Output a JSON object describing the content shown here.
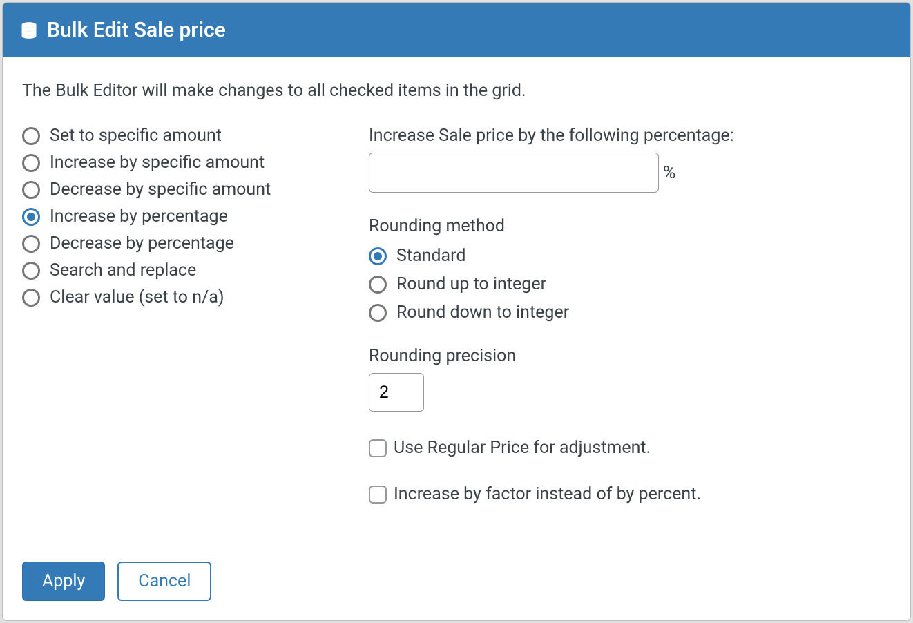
{
  "header": {
    "title": "Bulk Edit Sale price"
  },
  "description": "The Bulk Editor will make changes to all checked items in the grid.",
  "operations": {
    "selected": "increase_percent",
    "items": [
      {
        "id": "set_specific",
        "label": "Set to specific amount"
      },
      {
        "id": "increase_specific",
        "label": "Increase by specific amount"
      },
      {
        "id": "decrease_specific",
        "label": "Decrease by specific amount"
      },
      {
        "id": "increase_percent",
        "label": "Increase by percentage"
      },
      {
        "id": "decrease_percent",
        "label": "Decrease by percentage"
      },
      {
        "id": "search_replace",
        "label": "Search and replace"
      },
      {
        "id": "clear_value",
        "label": "Clear value (set to n/a)"
      }
    ]
  },
  "percentage_field": {
    "label": "Increase Sale price by the following percentage:",
    "value": "",
    "suffix": "%"
  },
  "rounding_method": {
    "heading": "Rounding method",
    "selected": "standard",
    "items": [
      {
        "id": "standard",
        "label": "Standard"
      },
      {
        "id": "round_up",
        "label": "Round up to integer"
      },
      {
        "id": "round_down",
        "label": "Round down to integer"
      }
    ]
  },
  "rounding_precision": {
    "heading": "Rounding precision",
    "value": "2"
  },
  "checkbox_use_regular": {
    "label": "Use Regular Price for adjustment.",
    "checked": false
  },
  "checkbox_factor": {
    "label": "Increase by factor instead of by percent.",
    "checked": false
  },
  "footer": {
    "apply": "Apply",
    "cancel": "Cancel"
  }
}
